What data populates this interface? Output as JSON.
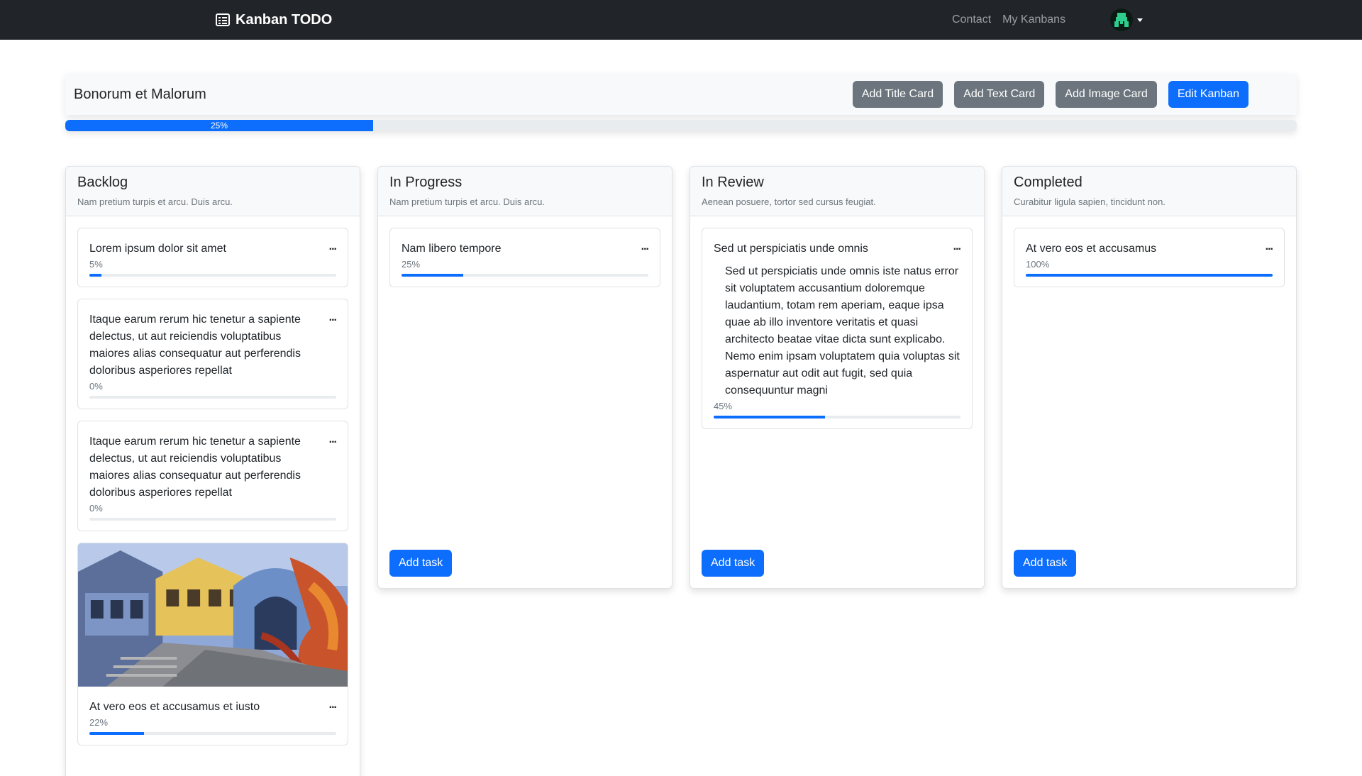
{
  "navbar": {
    "brand": "Kanban TODO",
    "links": [
      "Contact",
      "My Kanbans"
    ]
  },
  "kanban": {
    "title": "Bonorum et Malorum",
    "buttons": {
      "add_title_card": "Add Title Card",
      "add_text_card": "Add Text Card",
      "add_image_card": "Add Image Card",
      "edit_kanban": "Edit Kanban"
    },
    "progress": {
      "label": "25%",
      "value": 25
    }
  },
  "columns": [
    {
      "title": "Backlog",
      "subtitle": "Nam pretium turpis et arcu. Duis arcu.",
      "cards": [
        {
          "title": "Lorem ipsum dolor sit amet",
          "progress_label": "5%",
          "progress": 5
        },
        {
          "title": "Itaque earum rerum hic tenetur a sapiente delectus, ut aut reiciendis voluptatibus maiores alias consequatur aut perferendis doloribus asperiores repellat",
          "progress_label": "0%",
          "progress": 0
        },
        {
          "title": "Itaque earum rerum hic tenetur a sapiente delectus, ut aut reiciendis voluptatibus maiores alias consequatur aut perferendis doloribus asperiores repellat",
          "progress_label": "0%",
          "progress": 0
        },
        {
          "title": "At vero eos et accusamus et iusto",
          "progress_label": "22%",
          "progress": 22,
          "image": "photo-colorful-old-houses-street"
        }
      ]
    },
    {
      "title": "In Progress",
      "subtitle": "Nam pretium turpis et arcu. Duis arcu.",
      "add_task": "Add task",
      "cards": [
        {
          "title": "Nam libero tempore",
          "progress_label": "25%",
          "progress": 25
        }
      ]
    },
    {
      "title": "In Review",
      "subtitle": "Aenean posuere, tortor sed cursus feugiat.",
      "add_task": "Add task",
      "cards": [
        {
          "title": "Sed ut perspiciatis unde omnis",
          "text": "Sed ut perspiciatis unde omnis iste natus error sit voluptatem accusantium doloremque laudantium, totam rem aperiam, eaque ipsa quae ab illo inventore veritatis et quasi architecto beatae vitae dicta sunt explicabo. Nemo enim ipsam voluptatem quia voluptas sit aspernatur aut odit aut fugit, sed quia consequuntur magni",
          "progress_label": "45%",
          "progress": 45
        }
      ]
    },
    {
      "title": "Completed",
      "subtitle": "Curabitur ligula sapien, tincidunt non.",
      "add_task": "Add task",
      "cards": [
        {
          "title": "At vero eos et accusamus",
          "progress_label": "100%",
          "progress": 100
        }
      ]
    }
  ],
  "card_menu": "...",
  "colors": {
    "navbar": "#212529",
    "primary": "#0d6efd",
    "secondary": "#6c757d"
  }
}
